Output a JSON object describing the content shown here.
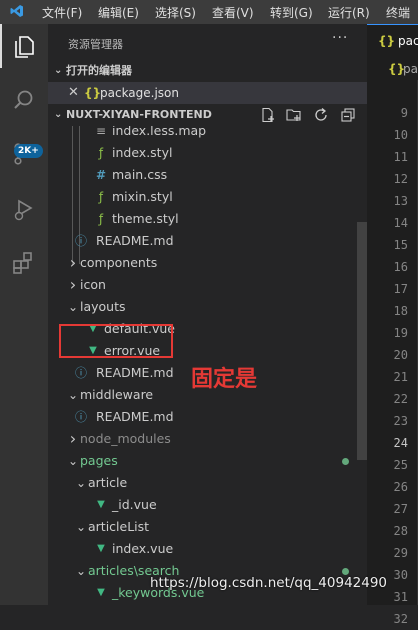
{
  "menubar": [
    "文件(F)",
    "编辑(E)",
    "选择(S)",
    "查看(V)",
    "转到(G)",
    "运行(R)",
    "终端"
  ],
  "activity": {
    "badge": "2K+"
  },
  "sidebar": {
    "title": "资源管理器",
    "more": "···",
    "open_editors": {
      "label": "打开的编辑器",
      "files": [
        {
          "name": "package.json",
          "icon": "{}"
        }
      ]
    },
    "project": {
      "label": "NUXT-XIYAN-FRONTEND"
    },
    "tree": [
      {
        "name": "index.less.map",
        "icon": "file-icon",
        "depth": 2
      },
      {
        "name": "index.styl",
        "icon": "stylus-icon",
        "depth": 2
      },
      {
        "name": "main.css",
        "icon": "css-hash-icon",
        "depth": 2
      },
      {
        "name": "mixin.styl",
        "icon": "stylus-icon",
        "depth": 2
      },
      {
        "name": "theme.styl",
        "icon": "stylus-icon",
        "depth": 2
      },
      {
        "name": "README.md",
        "icon": "info-icon",
        "depth": 1
      },
      {
        "name": "components",
        "icon": "chevron-right",
        "depth": 0
      },
      {
        "name": "icon",
        "icon": "chevron-right",
        "depth": 0
      },
      {
        "name": "layouts",
        "icon": "chevron-down",
        "depth": 0
      },
      {
        "name": "default.vue",
        "icon": "vue-icon",
        "depth": 1
      },
      {
        "name": "error.vue",
        "icon": "vue-icon",
        "depth": 1
      },
      {
        "name": "README.md",
        "icon": "info-icon",
        "depth": 1
      },
      {
        "name": "middleware",
        "icon": "chevron-down",
        "depth": 0
      },
      {
        "name": "README.md",
        "icon": "info-icon",
        "depth": 1
      },
      {
        "name": "node_modules",
        "icon": "chevron-right",
        "depth": 0,
        "dim": true
      },
      {
        "name": "pages",
        "icon": "chevron-down",
        "depth": 0,
        "green": true
      },
      {
        "name": "article",
        "icon": "chevron-down",
        "depth": 1
      },
      {
        "name": "_id.vue",
        "icon": "vue-icon",
        "depth": 2
      },
      {
        "name": "articleList",
        "icon": "chevron-down",
        "depth": 1
      },
      {
        "name": "index.vue",
        "icon": "vue-icon",
        "depth": 2
      },
      {
        "name": "articles\\search",
        "icon": "chevron-down",
        "depth": 1,
        "green": true
      },
      {
        "name": "_keywords.vue",
        "icon": "vue-icon",
        "depth": 2,
        "green": true
      }
    ]
  },
  "editor": {
    "tab": {
      "icon": "{}",
      "name": "package.json"
    },
    "breadcrumb": {
      "icon": "{}",
      "name": "package.json"
    },
    "line_numbers": [
      9,
      10,
      11,
      12,
      13,
      14,
      15,
      16,
      17,
      18,
      19,
      20,
      21,
      22,
      23,
      24,
      25,
      26,
      27,
      28,
      29,
      30,
      31,
      32
    ],
    "current_line": 24
  },
  "annotation": {
    "text": "固定是"
  },
  "watermark": "https://blog.csdn.net/qq_40942490",
  "colors": {
    "vue": "#41b883",
    "stylus": "#8dc149",
    "css": "#519aba",
    "info": "#519aba",
    "json": "#cbcb41",
    "annotation": "#e53935"
  }
}
